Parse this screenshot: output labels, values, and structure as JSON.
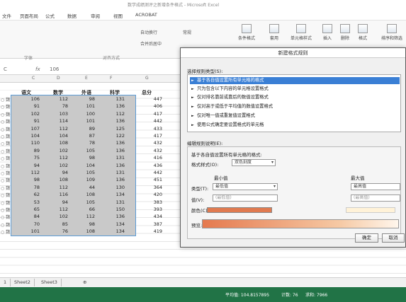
{
  "title": "数学成绩测评之新增条件格式 - Microsoft Excel",
  "menu": [
    "文件",
    "页面布局",
    "公式",
    "数据",
    "审阅",
    "视图",
    "ACROBAT"
  ],
  "ribbon": {
    "wrap_text": "自动换行",
    "merge_center": "合并后居中",
    "number_format": "常规",
    "font_group": "字体",
    "align_group": "对齐方式",
    "conditional_format": "条件格式",
    "table_style": "套用",
    "cell_style": "单元格样式",
    "insert": "插入",
    "delete": "删除",
    "format": "格式",
    "sort": "排序和筛选"
  },
  "formula_bar": {
    "cell_ref": "C",
    "fx": "fx",
    "value": "106"
  },
  "col_headers": [
    "C",
    "D",
    "E",
    "F",
    "G"
  ],
  "table": {
    "headers": [
      "语文",
      "数学",
      "外语",
      "科学",
      "总分"
    ],
    "rows": [
      [
        "106",
        "112",
        "98",
        "131",
        "447"
      ],
      [
        "91",
        "78",
        "101",
        "136",
        "406"
      ],
      [
        "102",
        "103",
        "100",
        "112",
        "417"
      ],
      [
        "91",
        "114",
        "101",
        "136",
        "442"
      ],
      [
        "107",
        "112",
        "89",
        "125",
        "433"
      ],
      [
        "104",
        "104",
        "87",
        "122",
        "417"
      ],
      [
        "110",
        "108",
        "78",
        "136",
        "432"
      ],
      [
        "89",
        "102",
        "105",
        "136",
        "432"
      ],
      [
        "75",
        "112",
        "98",
        "131",
        "416"
      ],
      [
        "94",
        "102",
        "104",
        "136",
        "436"
      ],
      [
        "112",
        "94",
        "105",
        "131",
        "442"
      ],
      [
        "98",
        "108",
        "109",
        "136",
        "451"
      ],
      [
        "78",
        "112",
        "44",
        "130",
        "364"
      ],
      [
        "62",
        "116",
        "108",
        "134",
        "420"
      ],
      [
        "53",
        "94",
        "105",
        "131",
        "383"
      ],
      [
        "65",
        "112",
        "66",
        "150",
        "393"
      ],
      [
        "84",
        "102",
        "112",
        "136",
        "434"
      ],
      [
        "70",
        "85",
        "98",
        "134",
        "387"
      ],
      [
        "101",
        "76",
        "108",
        "134",
        "419"
      ]
    ]
  },
  "dialog": {
    "title": "新建格式规则",
    "select_type_label": "选择规则类型(S):",
    "rule_types": [
      "基于各自值设置所有单元格的格式",
      "只为包含以下内容的单元格设置格式",
      "仅对排名靠前或靠后的数值设置格式",
      "仅对高于或低于平均值的数值设置格式",
      "仅对唯一值或重复值设置格式",
      "使用公式确定要设置格式的单元格"
    ],
    "edit_label": "编辑规则说明(E):",
    "format_all_label": "基于各自值设置所有单元格的格式:",
    "format_style_label": "格式样式(O):",
    "format_style_value": "双色刻度",
    "min_label": "最小值",
    "max_label": "最大值",
    "type_label": "类型(T):",
    "value_label": "值(V):",
    "color_label": "颜色(C):",
    "min_type": "最低值",
    "max_type": "最高值",
    "min_value": "(最低值)",
    "max_value": "(最高值)",
    "preview_label": "预览:",
    "ok": "确定",
    "cancel": "取消",
    "colors": {
      "min": "#e07a50",
      "max": "#fff2d8"
    }
  },
  "sheet_tabs": [
    "1",
    "Sheet2",
    "Sheet3"
  ],
  "status": {
    "average": "平均值: 104.8157895",
    "count": "计数: 76",
    "sum": "求和: 7966"
  }
}
